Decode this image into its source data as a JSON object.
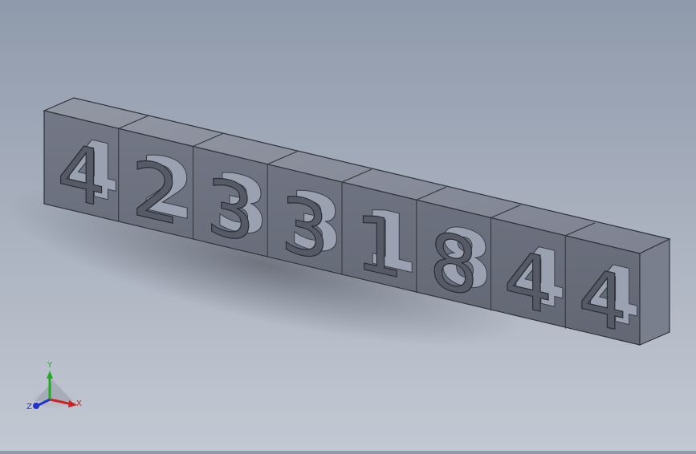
{
  "model": {
    "digits": [
      "4",
      "2",
      "3",
      "3",
      "1",
      "8",
      "4",
      "4"
    ],
    "face_color": "#6f7481",
    "top_color": "#8a8f9c",
    "side_color": "#7c8190"
  },
  "triad": {
    "x_label": "X",
    "y_label": "Y",
    "z_label": "Z",
    "x_color": "#cc2222",
    "y_color": "#22aa22",
    "z_color": "#2233cc"
  }
}
